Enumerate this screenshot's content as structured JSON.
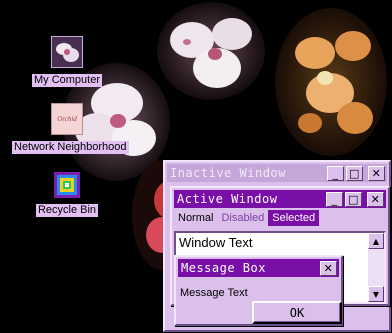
{
  "desktop": {
    "icons": [
      {
        "label": "My Computer",
        "icon": "orchid-photo-icon"
      },
      {
        "label": "Network Neighborhood",
        "icon": "orchid-card-icon",
        "card_text": "Orchid"
      },
      {
        "label": "Recycle Bin",
        "icon": "recycle-bin-icon"
      }
    ],
    "colors": {
      "background": "#000000",
      "icon_label_bg": "#e2c0f3"
    }
  },
  "inactive_window": {
    "title": "Inactive Window",
    "buttons": [
      "minimize",
      "maximize",
      "close"
    ]
  },
  "active_window": {
    "title": "Active Window",
    "menu": {
      "normal": "Normal",
      "disabled": "Disabled",
      "selected": "Selected"
    },
    "window_text": "Window Text",
    "buttons": [
      "minimize",
      "maximize",
      "close"
    ]
  },
  "message_box": {
    "title": "Message Box",
    "text": "Message Text",
    "ok_label": "OK"
  },
  "colors": {
    "active_title": "#7a0fa8",
    "inactive_title": "#c4a6d8",
    "window_face": "#dcc0ec",
    "window_bg": "#ffffff"
  }
}
